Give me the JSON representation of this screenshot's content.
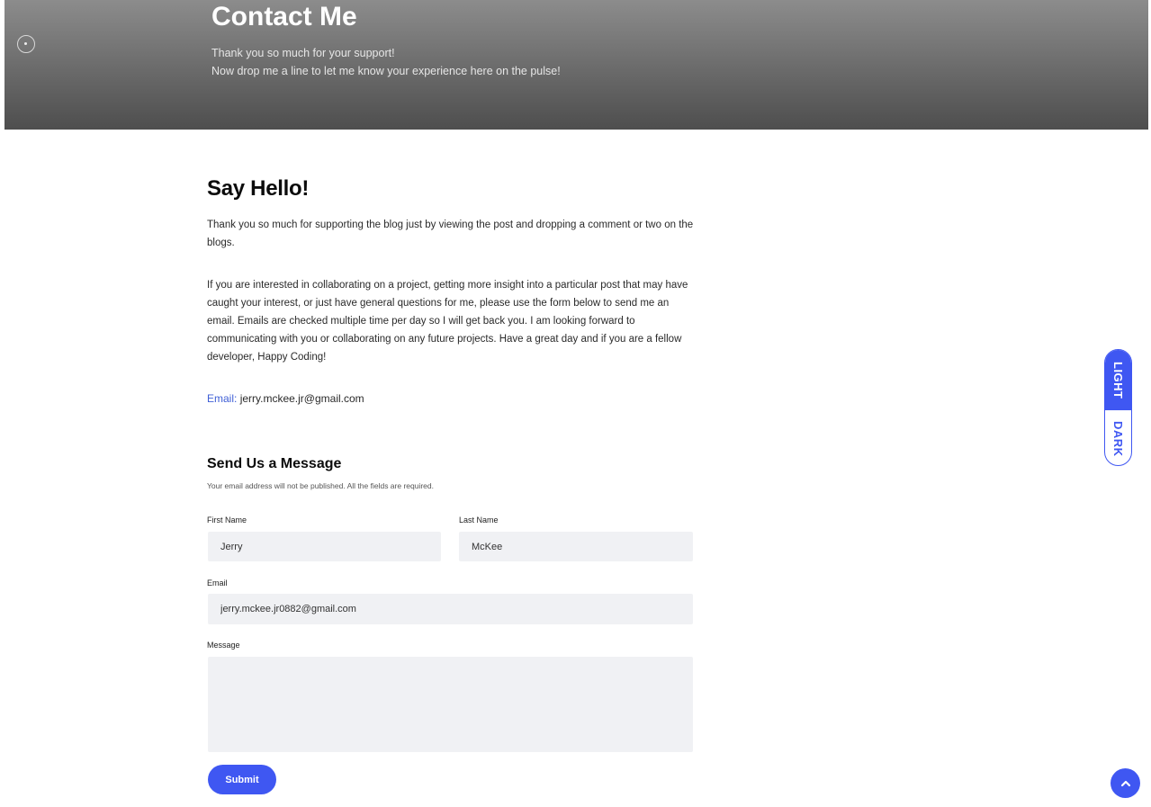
{
  "hero": {
    "title": "Contact Me",
    "line1": "Thank you so much for your support!",
    "line2": "Now drop me a line to let me know your experience here on the pulse!"
  },
  "intro": {
    "heading": "Say Hello!",
    "paragraph1": "Thank you so much for supporting the blog just by viewing the post and dropping a comment or two on the blogs.",
    "paragraph2": "If you are interested in collaborating on a project, getting more insight into a particular post that may have caught your interest, or just have general questions for me, please use the form below to send me an email. Emails are checked multiple time per day so I will get back you. I am looking forward to communicating with you or collaborating on any future projects. Have a great day and if you are a fellow developer, Happy Coding!",
    "email_label": "Email:",
    "email_value": "jerry.mckee.jr@gmail.com"
  },
  "form": {
    "heading": "Send Us a Message",
    "note": "Your email address will not be published. All the fields are required.",
    "first_name_label": "First Name",
    "first_name_value": "Jerry",
    "last_name_label": "Last Name",
    "last_name_value": "McKee",
    "email_label": "Email",
    "email_value": "jerry.mckee.jr0882@gmail.com",
    "message_label": "Message",
    "message_value": "",
    "submit_label": "Submit"
  },
  "theme_toggle": {
    "light_label": "LIGHT",
    "dark_label": "DARK",
    "active": "LIGHT"
  },
  "colors": {
    "accent": "#3f57f2",
    "email_label": "#3f5fd6",
    "field_bg": "#f0f1f4"
  },
  "icons": {
    "hero_icon": "circle-dot-icon",
    "back_to_top": "chevron-up-icon"
  }
}
